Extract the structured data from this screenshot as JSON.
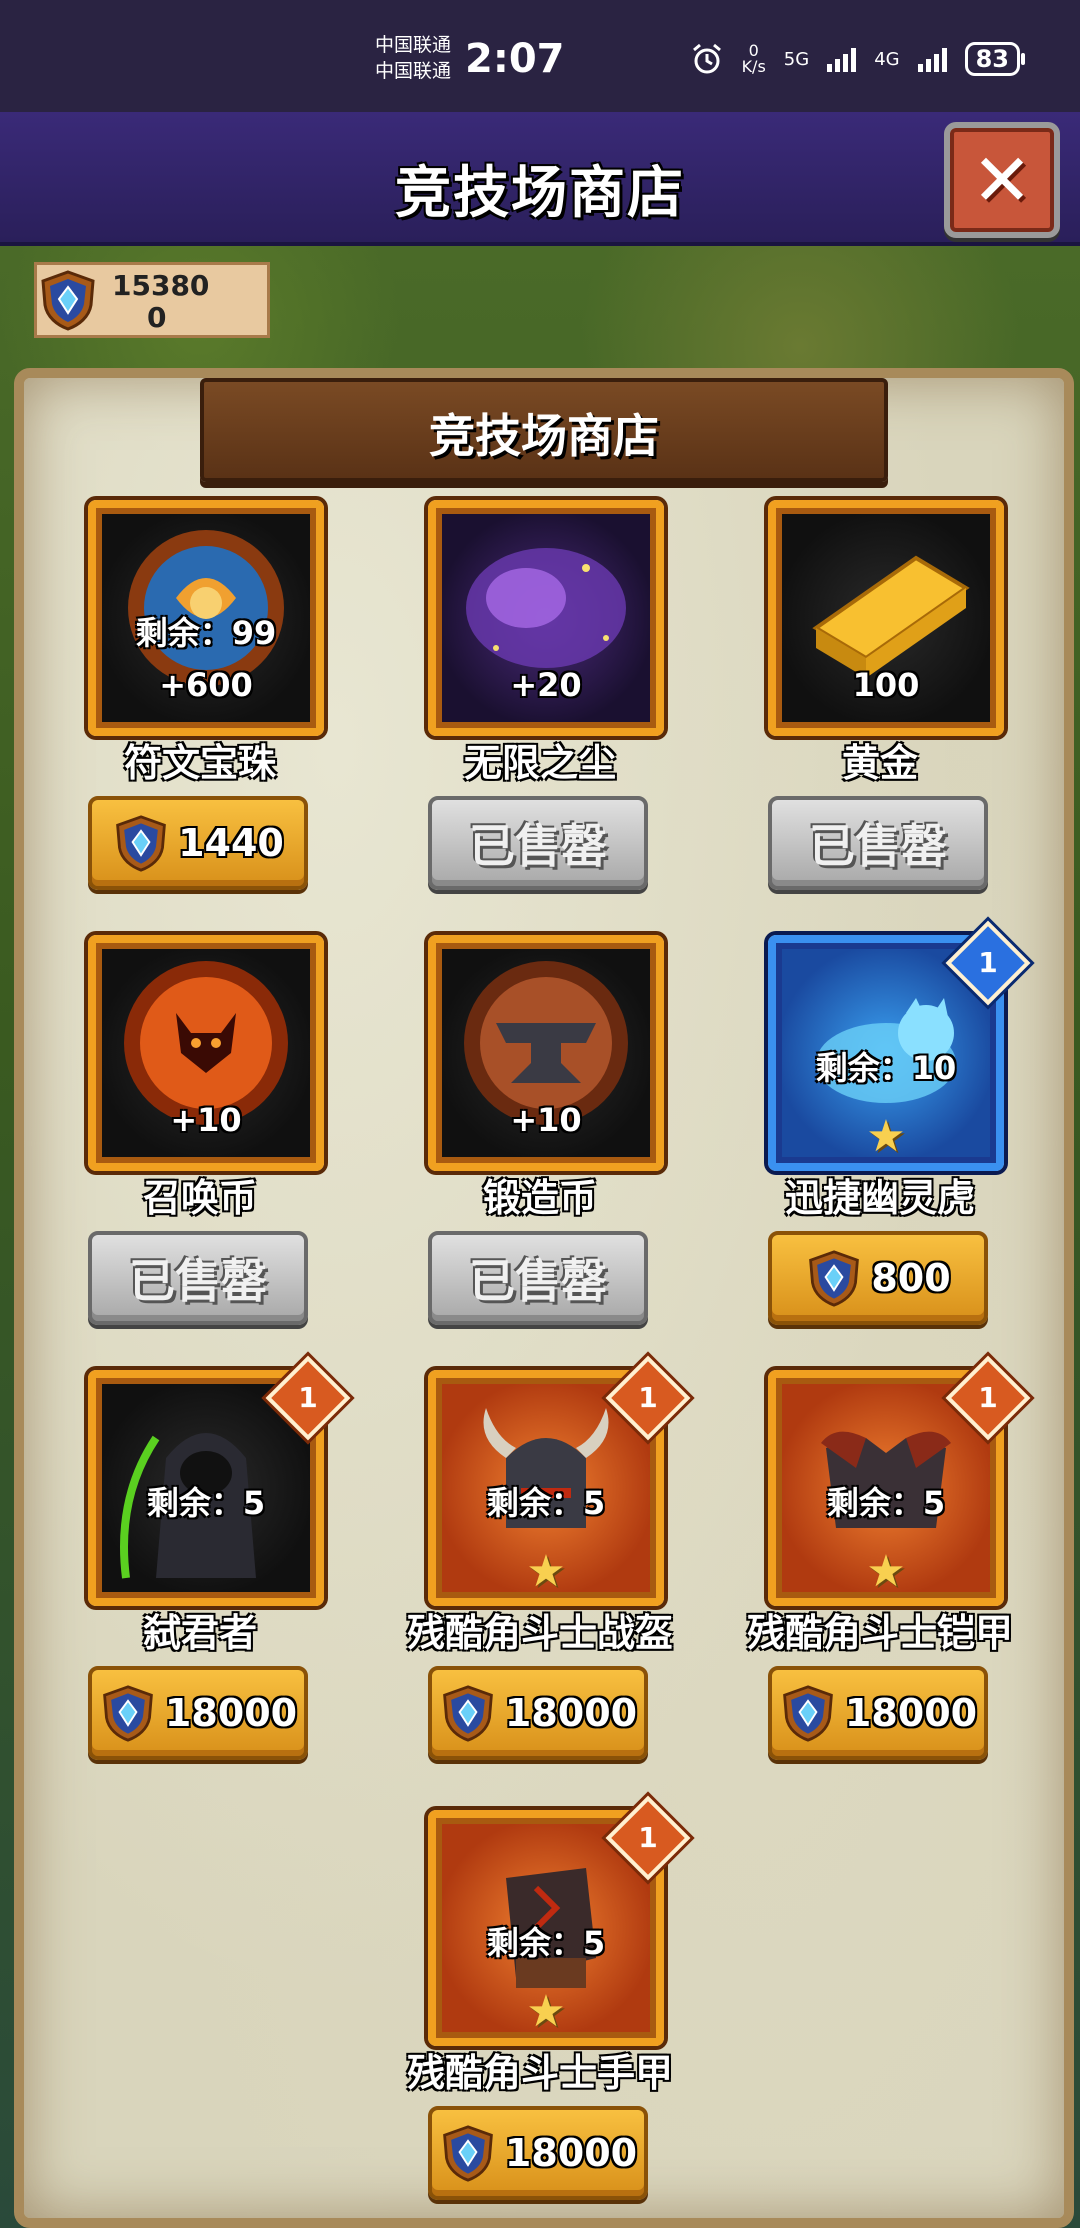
{
  "status_bar": {
    "carrier1": "中国联通",
    "carrier2": "中国联通",
    "time": "2:07",
    "net_speed": "0\nK/s",
    "net1": "5G",
    "net2": "4G",
    "battery": "83"
  },
  "header": {
    "title": "竞技场商店",
    "close_icon": "close-icon"
  },
  "currency": {
    "amount": "15380",
    "secondary": "0",
    "icon": "arena-shield-icon"
  },
  "banner": {
    "title": "竞技场商店"
  },
  "items": [
    {
      "name": "符文宝珠",
      "remaining": "剩余：99",
      "qty": "+600",
      "price": "1440",
      "status": "buy",
      "icon": "rune-orb-icon"
    },
    {
      "name": "无限之尘",
      "qty": "+20",
      "status_label": "已售罄",
      "status": "sold",
      "icon": "infinity-dust-icon"
    },
    {
      "name": "黄金",
      "qty": "100",
      "status_label": "已售罄",
      "status": "sold",
      "icon": "gold-bar-icon"
    },
    {
      "name": "召唤币",
      "qty": "+10",
      "status_label": "已售罄",
      "status": "sold",
      "icon": "summon-coin-icon"
    },
    {
      "name": "锻造币",
      "qty": "+10",
      "status_label": "已售罄",
      "status": "sold",
      "icon": "forge-coin-icon"
    },
    {
      "name": "迅捷幽灵虎",
      "remaining": "剩余：10",
      "badge": "1",
      "price": "800",
      "status": "buy",
      "icon": "spirit-tiger-icon"
    },
    {
      "name": "弑君者",
      "remaining": "剩余：5",
      "badge": "1",
      "price": "18000",
      "status": "buy",
      "icon": "assassin-hero-icon"
    },
    {
      "name": "残酷角斗士战盔",
      "remaining": "剩余：5",
      "badge": "1",
      "price": "18000",
      "status": "buy",
      "icon": "gladiator-helmet-icon"
    },
    {
      "name": "残酷角斗士铠甲",
      "remaining": "剩余：5",
      "badge": "1",
      "price": "18000",
      "status": "buy",
      "icon": "gladiator-armor-icon"
    },
    {
      "name": "残酷角斗士手甲",
      "remaining": "剩余：5",
      "badge": "1",
      "price": "18000",
      "status": "buy",
      "icon": "gladiator-gauntlet-icon"
    }
  ]
}
